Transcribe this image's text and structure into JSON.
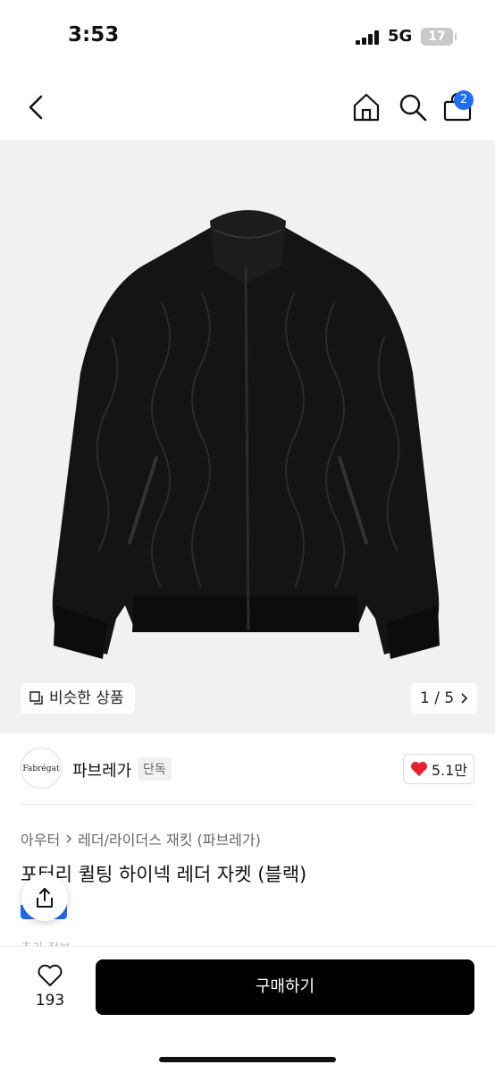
{
  "status_bar": {
    "time": "3:53",
    "network": "5G",
    "battery": "17"
  },
  "nav": {
    "cart_count": "2",
    "icons": [
      "back-icon",
      "home-icon",
      "search-icon",
      "cart-icon"
    ]
  },
  "gallery": {
    "similar_label": "비슷한 상품",
    "counter": "1 / 5"
  },
  "brand": {
    "logo_text": "Fabrégat",
    "name": "파브레가",
    "tag": "단독",
    "likes": "5.1만"
  },
  "product": {
    "breadcrumb": [
      "아우터",
      "레더/라이더스 재킷 (파브레가)"
    ],
    "title": "포터리 퀼팅 하이넥 레더 자켓 (블랙)",
    "partial_text": "추가 정보"
  },
  "bottom": {
    "wish_count": "193",
    "buy_label": "구매하기"
  },
  "colors": {
    "accent": "#1f6ef5",
    "like_heart": "#e8212e",
    "buy_bg": "#000000"
  }
}
